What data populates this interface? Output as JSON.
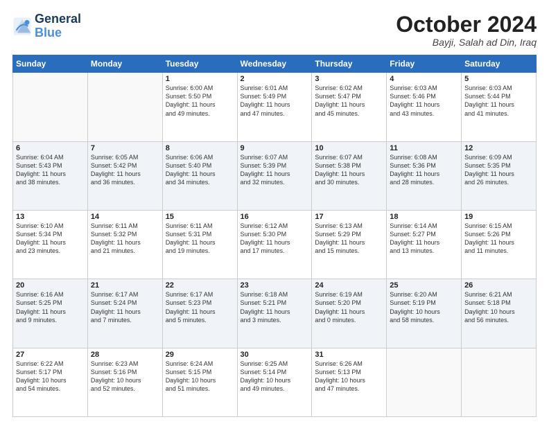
{
  "header": {
    "logo_line1": "General",
    "logo_line2": "Blue",
    "month": "October 2024",
    "location": "Bayji, Salah ad Din, Iraq"
  },
  "days_of_week": [
    "Sunday",
    "Monday",
    "Tuesday",
    "Wednesday",
    "Thursday",
    "Friday",
    "Saturday"
  ],
  "weeks": [
    [
      {
        "num": "",
        "info": ""
      },
      {
        "num": "",
        "info": ""
      },
      {
        "num": "1",
        "info": "Sunrise: 6:00 AM\nSunset: 5:50 PM\nDaylight: 11 hours\nand 49 minutes."
      },
      {
        "num": "2",
        "info": "Sunrise: 6:01 AM\nSunset: 5:49 PM\nDaylight: 11 hours\nand 47 minutes."
      },
      {
        "num": "3",
        "info": "Sunrise: 6:02 AM\nSunset: 5:47 PM\nDaylight: 11 hours\nand 45 minutes."
      },
      {
        "num": "4",
        "info": "Sunrise: 6:03 AM\nSunset: 5:46 PM\nDaylight: 11 hours\nand 43 minutes."
      },
      {
        "num": "5",
        "info": "Sunrise: 6:03 AM\nSunset: 5:44 PM\nDaylight: 11 hours\nand 41 minutes."
      }
    ],
    [
      {
        "num": "6",
        "info": "Sunrise: 6:04 AM\nSunset: 5:43 PM\nDaylight: 11 hours\nand 38 minutes."
      },
      {
        "num": "7",
        "info": "Sunrise: 6:05 AM\nSunset: 5:42 PM\nDaylight: 11 hours\nand 36 minutes."
      },
      {
        "num": "8",
        "info": "Sunrise: 6:06 AM\nSunset: 5:40 PM\nDaylight: 11 hours\nand 34 minutes."
      },
      {
        "num": "9",
        "info": "Sunrise: 6:07 AM\nSunset: 5:39 PM\nDaylight: 11 hours\nand 32 minutes."
      },
      {
        "num": "10",
        "info": "Sunrise: 6:07 AM\nSunset: 5:38 PM\nDaylight: 11 hours\nand 30 minutes."
      },
      {
        "num": "11",
        "info": "Sunrise: 6:08 AM\nSunset: 5:36 PM\nDaylight: 11 hours\nand 28 minutes."
      },
      {
        "num": "12",
        "info": "Sunrise: 6:09 AM\nSunset: 5:35 PM\nDaylight: 11 hours\nand 26 minutes."
      }
    ],
    [
      {
        "num": "13",
        "info": "Sunrise: 6:10 AM\nSunset: 5:34 PM\nDaylight: 11 hours\nand 23 minutes."
      },
      {
        "num": "14",
        "info": "Sunrise: 6:11 AM\nSunset: 5:32 PM\nDaylight: 11 hours\nand 21 minutes."
      },
      {
        "num": "15",
        "info": "Sunrise: 6:11 AM\nSunset: 5:31 PM\nDaylight: 11 hours\nand 19 minutes."
      },
      {
        "num": "16",
        "info": "Sunrise: 6:12 AM\nSunset: 5:30 PM\nDaylight: 11 hours\nand 17 minutes."
      },
      {
        "num": "17",
        "info": "Sunrise: 6:13 AM\nSunset: 5:29 PM\nDaylight: 11 hours\nand 15 minutes."
      },
      {
        "num": "18",
        "info": "Sunrise: 6:14 AM\nSunset: 5:27 PM\nDaylight: 11 hours\nand 13 minutes."
      },
      {
        "num": "19",
        "info": "Sunrise: 6:15 AM\nSunset: 5:26 PM\nDaylight: 11 hours\nand 11 minutes."
      }
    ],
    [
      {
        "num": "20",
        "info": "Sunrise: 6:16 AM\nSunset: 5:25 PM\nDaylight: 11 hours\nand 9 minutes."
      },
      {
        "num": "21",
        "info": "Sunrise: 6:17 AM\nSunset: 5:24 PM\nDaylight: 11 hours\nand 7 minutes."
      },
      {
        "num": "22",
        "info": "Sunrise: 6:17 AM\nSunset: 5:23 PM\nDaylight: 11 hours\nand 5 minutes."
      },
      {
        "num": "23",
        "info": "Sunrise: 6:18 AM\nSunset: 5:21 PM\nDaylight: 11 hours\nand 3 minutes."
      },
      {
        "num": "24",
        "info": "Sunrise: 6:19 AM\nSunset: 5:20 PM\nDaylight: 11 hours\nand 0 minutes."
      },
      {
        "num": "25",
        "info": "Sunrise: 6:20 AM\nSunset: 5:19 PM\nDaylight: 10 hours\nand 58 minutes."
      },
      {
        "num": "26",
        "info": "Sunrise: 6:21 AM\nSunset: 5:18 PM\nDaylight: 10 hours\nand 56 minutes."
      }
    ],
    [
      {
        "num": "27",
        "info": "Sunrise: 6:22 AM\nSunset: 5:17 PM\nDaylight: 10 hours\nand 54 minutes."
      },
      {
        "num": "28",
        "info": "Sunrise: 6:23 AM\nSunset: 5:16 PM\nDaylight: 10 hours\nand 52 minutes."
      },
      {
        "num": "29",
        "info": "Sunrise: 6:24 AM\nSunset: 5:15 PM\nDaylight: 10 hours\nand 51 minutes."
      },
      {
        "num": "30",
        "info": "Sunrise: 6:25 AM\nSunset: 5:14 PM\nDaylight: 10 hours\nand 49 minutes."
      },
      {
        "num": "31",
        "info": "Sunrise: 6:26 AM\nSunset: 5:13 PM\nDaylight: 10 hours\nand 47 minutes."
      },
      {
        "num": "",
        "info": ""
      },
      {
        "num": "",
        "info": ""
      }
    ]
  ]
}
